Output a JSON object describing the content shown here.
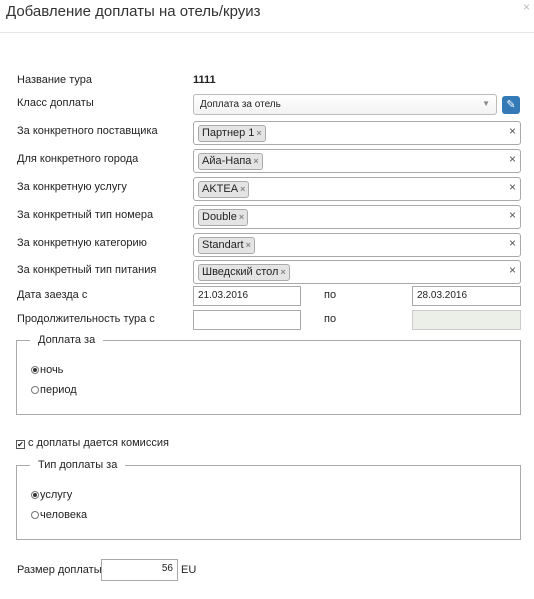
{
  "dialog": {
    "title": "Добавление доплаты на отель/круиз",
    "close": "×"
  },
  "tour_name": {
    "label": "Название тура",
    "value": "1111"
  },
  "surcharge_class": {
    "label": "Класс доплаты",
    "selected": "Доплата за отель",
    "edit_icon": "pencil-icon"
  },
  "tag_fields": [
    {
      "label": "За конкретного поставщика",
      "tag": "Партнер 1"
    },
    {
      "label": "Для конкретного города",
      "tag": "Айа-Напа"
    },
    {
      "label": "За конкретную услугу",
      "tag": "AKTEA"
    },
    {
      "label": "За конкретный тип номера",
      "tag": "Double"
    },
    {
      "label": "За конкретную категорию",
      "tag": "Standart"
    },
    {
      "label": "За конкретный тип питания",
      "tag": "Шведский стол"
    }
  ],
  "tag_remove": "×",
  "clear_symbol": "×",
  "checkin_date": {
    "label": "Дата заезда с",
    "from": "21.03.2016",
    "to_label": "по",
    "to": "28.03.2016"
  },
  "duration": {
    "label": "Продолжительность тура с",
    "from": "",
    "to_label": "по",
    "to": ""
  },
  "surcharge_for": {
    "legend": "Доплата за",
    "options": [
      {
        "label": "ночь",
        "selected": true
      },
      {
        "label": "период",
        "selected": false
      }
    ]
  },
  "commission": {
    "label": "с доплаты дается комиссия",
    "checked": true,
    "mark": "✔"
  },
  "surcharge_type": {
    "legend": "Тип доплаты за",
    "options": [
      {
        "label": "услугу",
        "selected": true
      },
      {
        "label": "человека",
        "selected": false
      }
    ]
  },
  "amount": {
    "label": "Размер доплаты",
    "value": "56",
    "currency": "EU"
  },
  "colors": {
    "accent": "#337ab7",
    "border": "#aaaaaa",
    "disabled_bg": "#eceee8"
  }
}
